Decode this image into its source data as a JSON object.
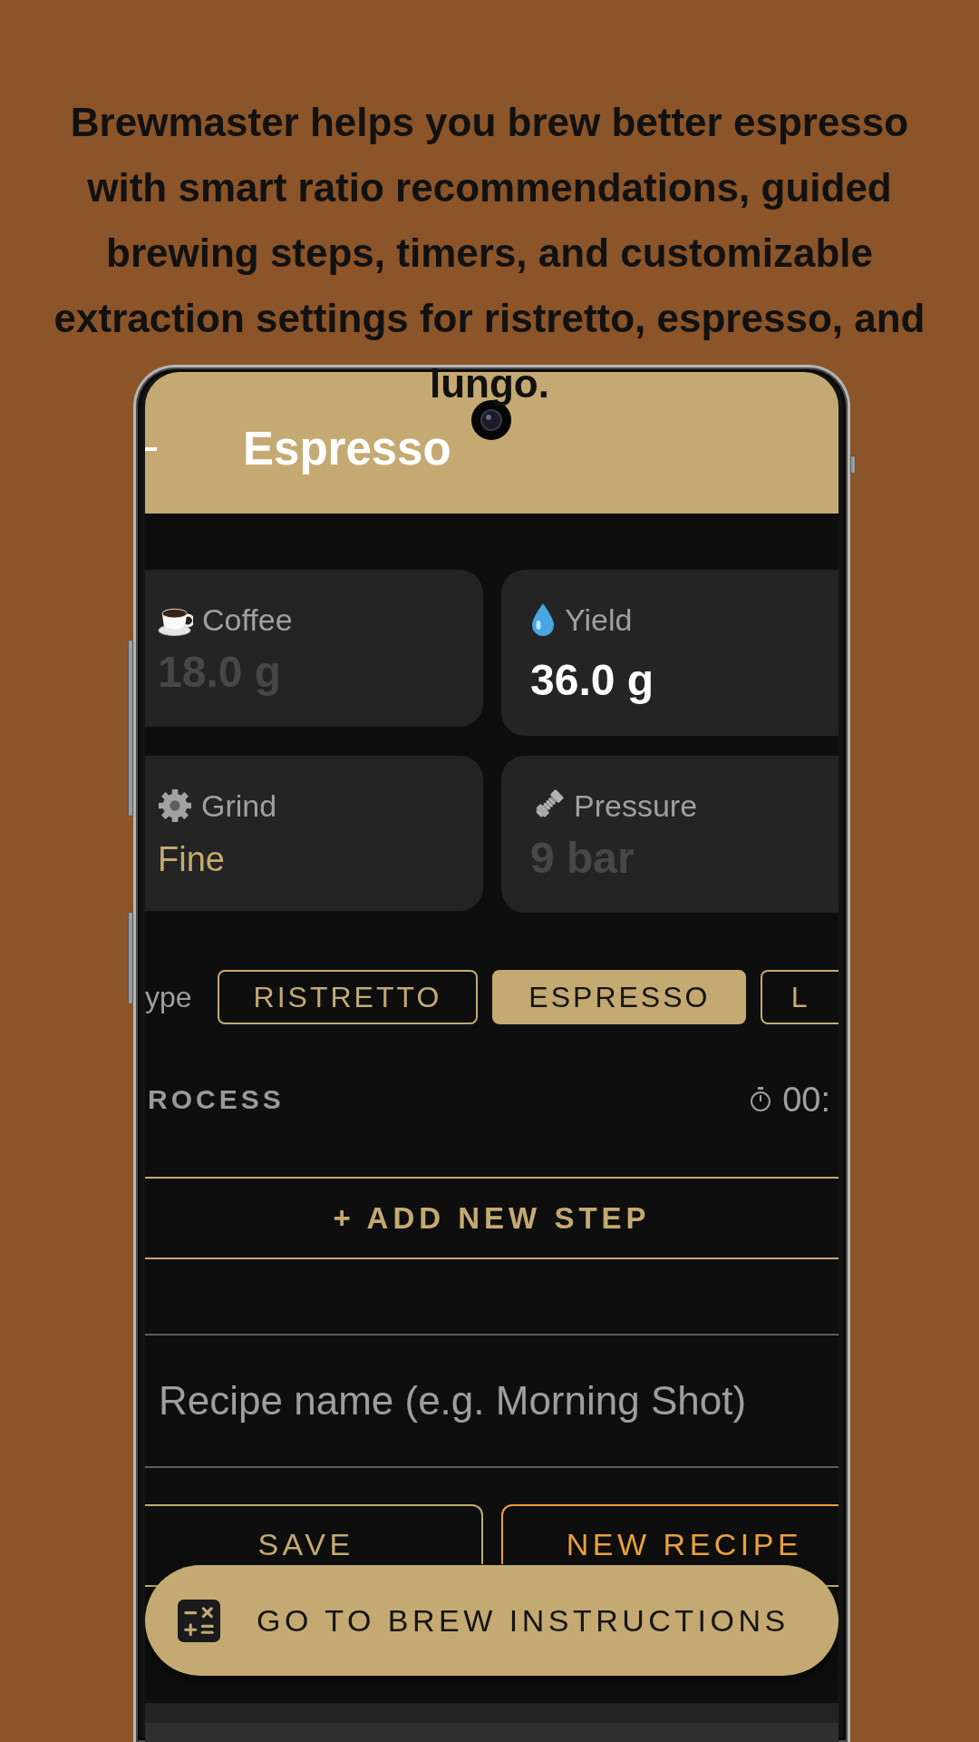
{
  "caption": "Brewmaster helps you brew better espresso with smart ratio recommendations, guided brewing steps, timers, and customizable extraction settings for ristretto, espresso, and lungo.",
  "app_bar": {
    "title": "Espresso"
  },
  "cards": [
    {
      "kind": "input",
      "label": "Coffee",
      "placeholder": "18.0 g"
    },
    {
      "kind": "computed",
      "label": "Yield",
      "value": "36.0 g"
    },
    {
      "kind": "select",
      "label": "Grind",
      "value": "Fine"
    },
    {
      "kind": "input",
      "label": "Pressure",
      "placeholder": "9 bar"
    }
  ],
  "type_selector": {
    "label": "ype",
    "options": [
      {
        "label": "RISTRETTO",
        "selected": false
      },
      {
        "label": "ESPRESSO",
        "selected": true
      },
      {
        "label": "L",
        "selected": false
      }
    ]
  },
  "process": {
    "title": "ROCESS",
    "timer": "00:"
  },
  "add_step_button": "+ ADD NEW STEP",
  "recipe_name": {
    "placeholder": "Recipe name (e.g. Morning Shot)"
  },
  "buttons": [
    {
      "kind": "save",
      "label": "SAVE"
    },
    {
      "kind": "new",
      "label": "NEW RECIPE"
    }
  ],
  "fab": {
    "label": "GO TO BREW INSTRUCTIONS"
  }
}
